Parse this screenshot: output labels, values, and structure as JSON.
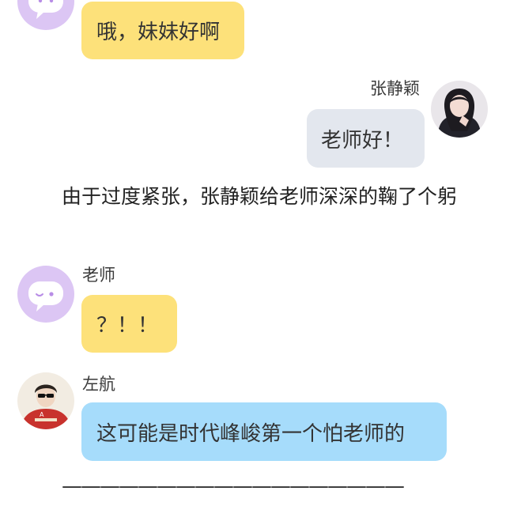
{
  "messages": [
    {
      "sender": "",
      "text": "哦，妹妹好啊"
    },
    {
      "sender": "张静颖",
      "text": "老师好！"
    },
    {
      "sender": "老师",
      "text": "？！！"
    },
    {
      "sender": "左航",
      "text": "这可能是时代峰峻第一个怕老师的"
    }
  ],
  "narration": "由于过度紧张，张静颖给老师深深的鞠了个躬",
  "divider": "——————————————————",
  "avatars": {
    "teacher": "chat-bubble-face-icon",
    "zhang": "girl-photo-avatar",
    "zuo": "boy-photo-avatar"
  },
  "colors": {
    "yellow_bubble": "#fde17a",
    "gray_bubble": "#e3e7ee",
    "blue_bubble": "#a6dcfb",
    "teacher_avatar_bg": "#dcc6f4"
  }
}
